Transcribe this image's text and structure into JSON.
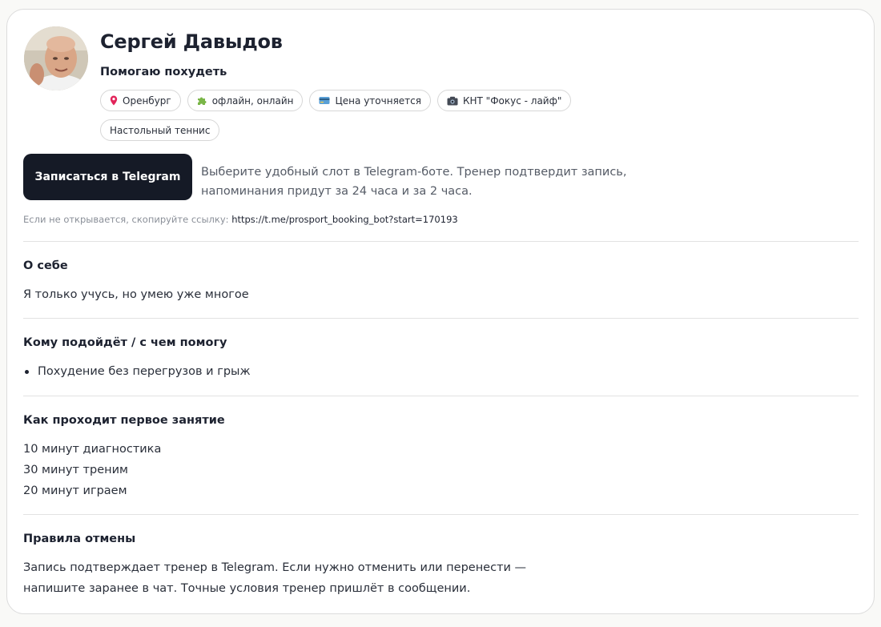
{
  "profile": {
    "name": "Сергей Давыдов",
    "tagline": "Помогаю похудеть"
  },
  "chips": [
    {
      "icon": "pin-icon",
      "label": "Оренбург"
    },
    {
      "icon": "puzzle-icon",
      "label": "офлайн, онлайн"
    },
    {
      "icon": "card-icon",
      "label": "Цена уточняется"
    },
    {
      "icon": "camera-icon",
      "label": "КНТ \"Фокус - лайф\""
    },
    {
      "icon": "",
      "label": "Настольный теннис"
    }
  ],
  "booking": {
    "button_label": "Записаться в Telegram",
    "hint_line1": "Выберите удобный слот в Telegram-боте. Тренер подтвердит запись,",
    "hint_line2": "напоминания придут за 24 часа и за 2 часа.",
    "fallback_label": "Если не открывается, скопируйте ссылку: ",
    "fallback_link": "https://t.me/prosport_booking_bot?start=170193"
  },
  "about": {
    "title": "О себе",
    "text": "Я только учусь, но умею уже многое"
  },
  "audience": {
    "title": "Кому подойдёт / с чем помогу",
    "items": [
      "Похудение без перегрузов и грыж"
    ]
  },
  "first_session": {
    "title": "Как проходит первое занятие",
    "lines": [
      "10 минут диагностика",
      "30 минут треним",
      "20 минут играем"
    ]
  },
  "cancel_policy": {
    "title": "Правила отмены",
    "line1": "Запись подтверждает тренер в Telegram. Если нужно отменить или перенести —",
    "line2": "напишите заранее в чат. Точные условия тренер пришлёт в сообщении."
  },
  "colors": {
    "button_bg": "#151a26",
    "page_bg": "#f9f9f7",
    "card_bg": "#ffffff"
  }
}
